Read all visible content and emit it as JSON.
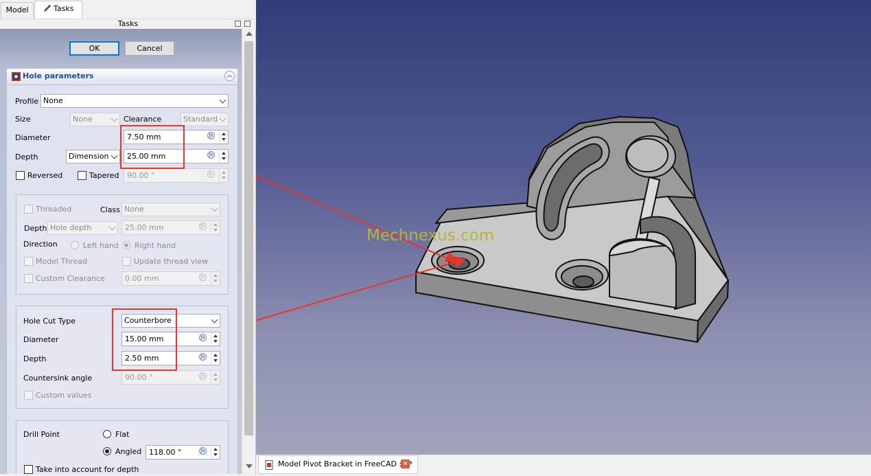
{
  "tabs": {
    "model": "Model",
    "tasks": "Tasks"
  },
  "tasks_header": "Tasks",
  "buttons": {
    "ok": "OK",
    "cancel": "Cancel"
  },
  "hole_parameters": {
    "title": "Hole parameters",
    "profile_label": "Profile",
    "profile_value": "None",
    "size_label": "Size",
    "size_value": "None",
    "clearance_label": "Clearance",
    "clearance_value": "Standard",
    "diameter_label": "Diameter",
    "diameter_value": "7.50 mm",
    "depth_label": "Depth",
    "depth_type": "Dimension",
    "depth_value": "25.00 mm",
    "reversed_label": "Reversed",
    "tapered_label": "Tapered",
    "taper_angle": "90.00 °"
  },
  "thread": {
    "threaded_label": "Threaded",
    "class_label": "Class",
    "class_value": "None",
    "depth_label": "Depth",
    "depth_type": "Hole depth",
    "depth_value": "25.00 mm",
    "direction_label": "Direction",
    "left_hand": "Left hand",
    "right_hand": "Right hand",
    "model_thread": "Model Thread",
    "update_thread_view": "Update thread view",
    "custom_clearance": "Custom Clearance",
    "custom_clearance_value": "0.00 mm"
  },
  "holecut": {
    "type_label": "Hole Cut Type",
    "type_value": "Counterbore",
    "diameter_label": "Diameter",
    "diameter_value": "15.00 mm",
    "depth_label": "Depth",
    "depth_value": "2.50 mm",
    "countersink_label": "Countersink angle",
    "countersink_value": "90.00 °",
    "custom_values": "Custom values"
  },
  "drill": {
    "drill_point_label": "Drill Point",
    "flat": "Flat",
    "angled": "Angled",
    "angle_value": "118.00 °",
    "take_into_account": "Take into account for depth"
  },
  "viewport": {
    "watermark": "Mechnexus.com",
    "document_tab": "Model Pivot Bracket in FreeCAD : 1*"
  },
  "colors": {
    "highlight": "#e8342a",
    "link_blue": "#1f4fa8"
  }
}
